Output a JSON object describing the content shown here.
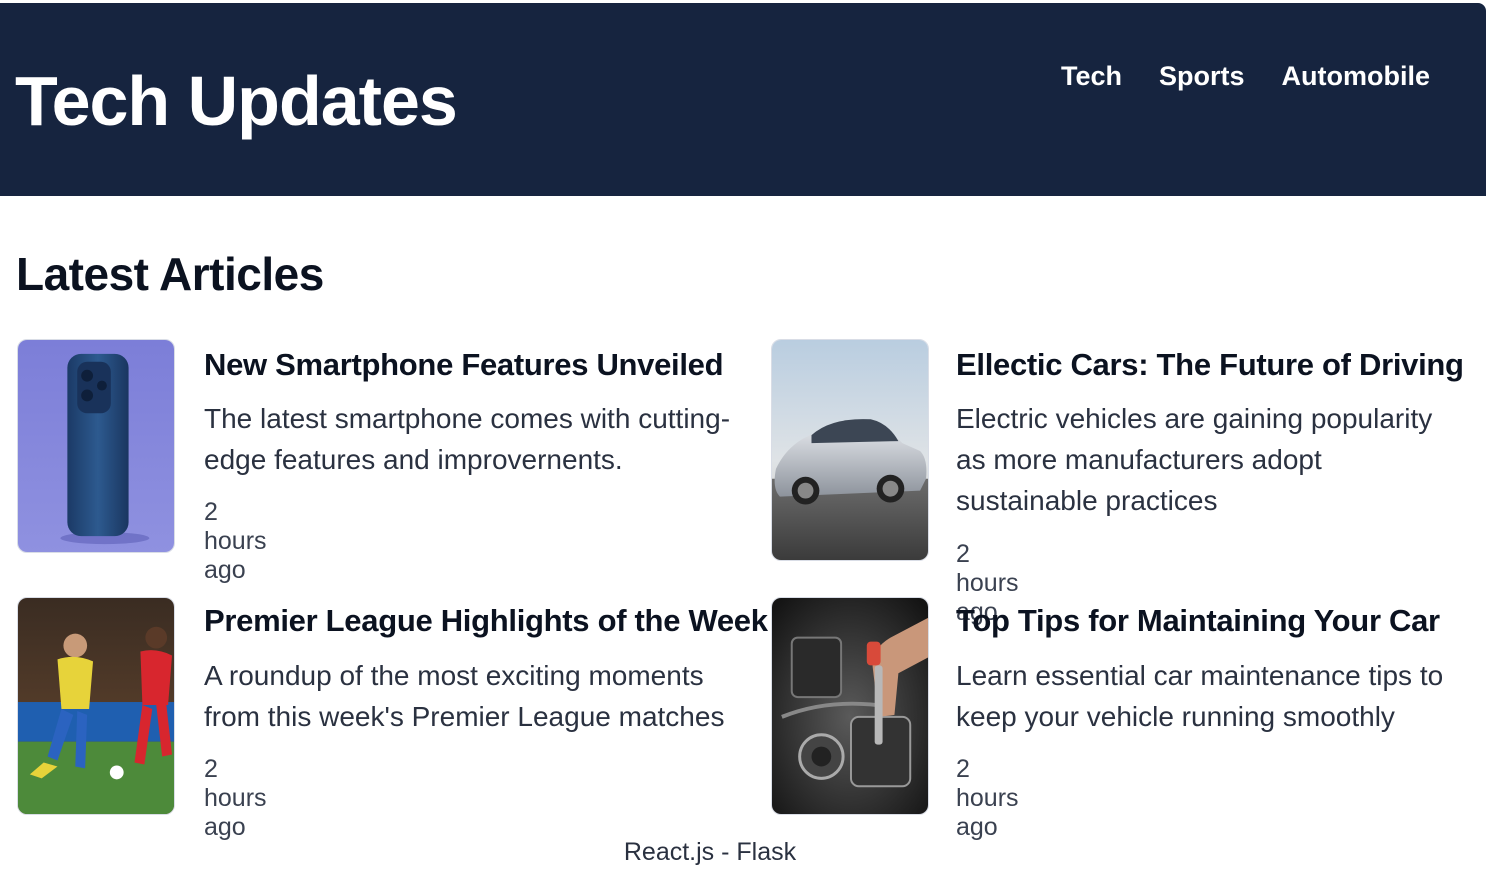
{
  "header": {
    "title": "Tech Updates",
    "nav": [
      "Tech",
      "Sports",
      "Automobile"
    ]
  },
  "main": {
    "section_title": "Latest Articles",
    "articles": [
      {
        "title": "New Smartphone Features Unveiled",
        "description": "The latest smartphone comes with cutting-edge features and improvernents.",
        "time": "2 hours ago",
        "image_icon": "smartphone-image"
      },
      {
        "title": "Ellectic Cars: The Future of Driving",
        "description": "Electric vehicles are gaining popularity as more manufacturers adopt sustainable practices",
        "time": "2 hours ago",
        "image_icon": "electric-car-image"
      },
      {
        "title": "Premier League Highlights of the Week",
        "description": "A roundup of the most exciting moments from this week's Premier League matches",
        "time": "2 hours ago",
        "image_icon": "football-players-image"
      },
      {
        "title": "Top Tips for Maintaining Your Car",
        "description": "Learn essential car maintenance tips to keep your vehicle running smoothly",
        "time": "2 hours ago",
        "image_icon": "car-engine-image"
      }
    ]
  },
  "footer": {
    "text": "React.js - Flask"
  },
  "colors": {
    "header_bg": "#16243f",
    "text": "#0b1220",
    "background": "#ffffff"
  }
}
